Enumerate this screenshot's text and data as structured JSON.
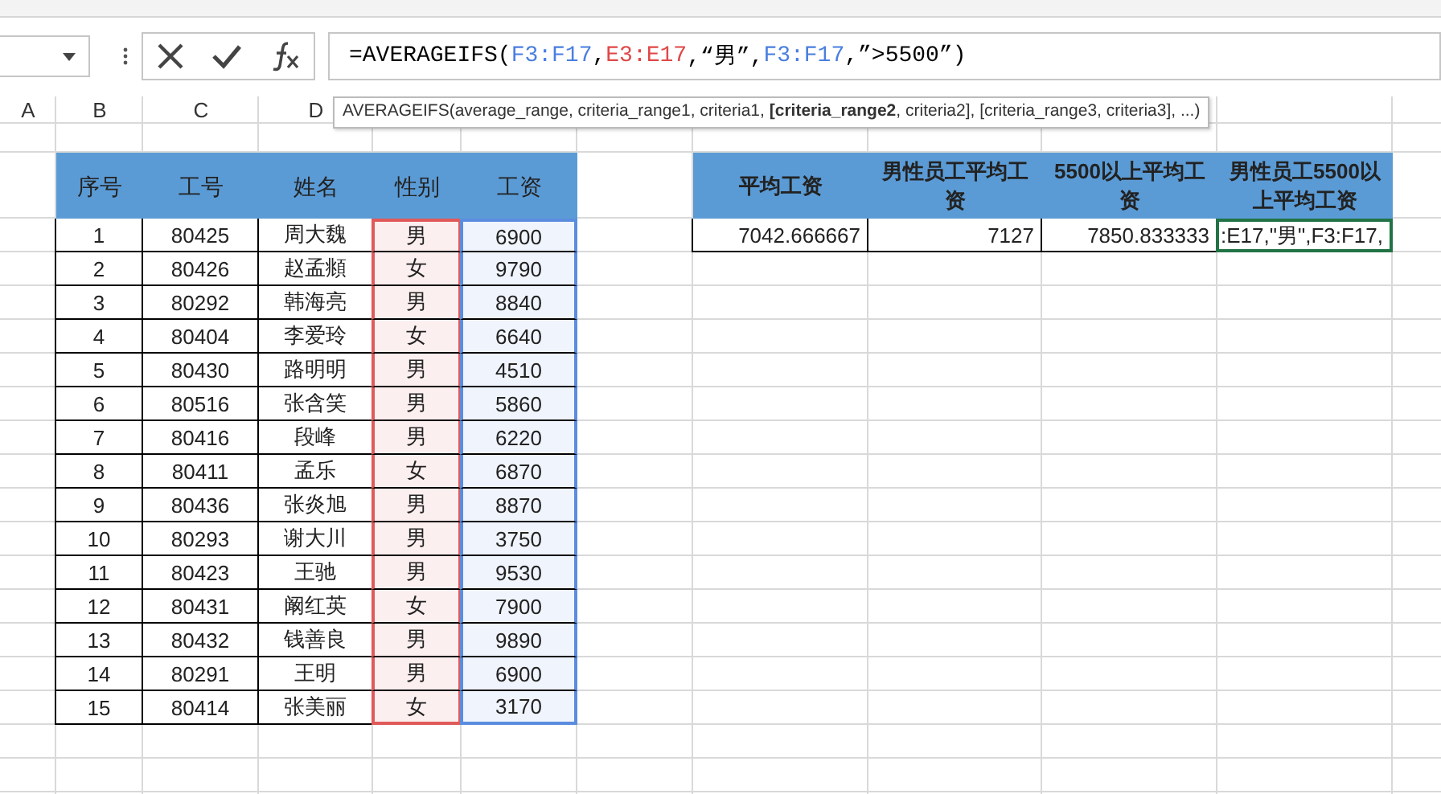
{
  "formula_bar": {
    "parts": [
      {
        "text": "=AVERAGEIFS(",
        "color": "#000000"
      },
      {
        "text": "F3:F17",
        "color": "#4a7fe0"
      },
      {
        "text": ",",
        "color": "#000000"
      },
      {
        "text": "E3:E17",
        "color": "#e04848"
      },
      {
        "text": ",“男”,",
        "color": "#000000"
      },
      {
        "text": "F3:F17",
        "color": "#4a7fe0"
      },
      {
        "text": ",”>5500”)",
        "color": "#000000"
      }
    ]
  },
  "tooltip": {
    "text": "AVERAGEIFS(average_range, criteria_range1, criteria1, **[criteria_range2**, criteria2], [criteria_range3, criteria3], ...)"
  },
  "column_headers": [
    "A",
    "B",
    "C",
    "D"
  ],
  "employee_table": {
    "columns": [
      {
        "label": "序号"
      },
      {
        "label": "工号"
      },
      {
        "label": "姓名"
      },
      {
        "label": "性别",
        "color": "#e05a5a"
      },
      {
        "label": "工资",
        "color": "#5b8ddf"
      }
    ],
    "rows": [
      [
        "1",
        "80425",
        "周大魏",
        "男",
        "6900"
      ],
      [
        "2",
        "80426",
        "赵孟頫",
        "女",
        "9790"
      ],
      [
        "3",
        "80292",
        "韩海亮",
        "男",
        "8840"
      ],
      [
        "4",
        "80404",
        "李爱玲",
        "女",
        "6640"
      ],
      [
        "5",
        "80430",
        "路明明",
        "男",
        "4510"
      ],
      [
        "6",
        "80516",
        "张含笑",
        "男",
        "5860"
      ],
      [
        "7",
        "80416",
        "段峰",
        "男",
        "6220"
      ],
      [
        "8",
        "80411",
        "孟乐",
        "女",
        "6870"
      ],
      [
        "9",
        "80436",
        "张炎旭",
        "男",
        "8870"
      ],
      [
        "10",
        "80293",
        "谢大川",
        "男",
        "3750"
      ],
      [
        "11",
        "80423",
        "王驰",
        "男",
        "9530"
      ],
      [
        "12",
        "80431",
        "阚红英",
        "女",
        "7900"
      ],
      [
        "13",
        "80432",
        "钱善良",
        "男",
        "9890"
      ],
      [
        "14",
        "80291",
        "王明",
        "男",
        "6900"
      ],
      [
        "15",
        "80414",
        "张美丽",
        "女",
        "3170"
      ]
    ]
  },
  "summary_table": {
    "columns": [
      "平均工资",
      "男性员工平均工资",
      "5500以上平均工资",
      "男性员工5500以上平均工资"
    ],
    "cells": [
      {
        "text": "7042.666667",
        "editing": false
      },
      {
        "text": "7127",
        "editing": false
      },
      {
        "text": "7850.833333",
        "editing": false
      },
      {
        "text": ":E17,\"男\",F3:F17,",
        "editing": true
      }
    ]
  }
}
